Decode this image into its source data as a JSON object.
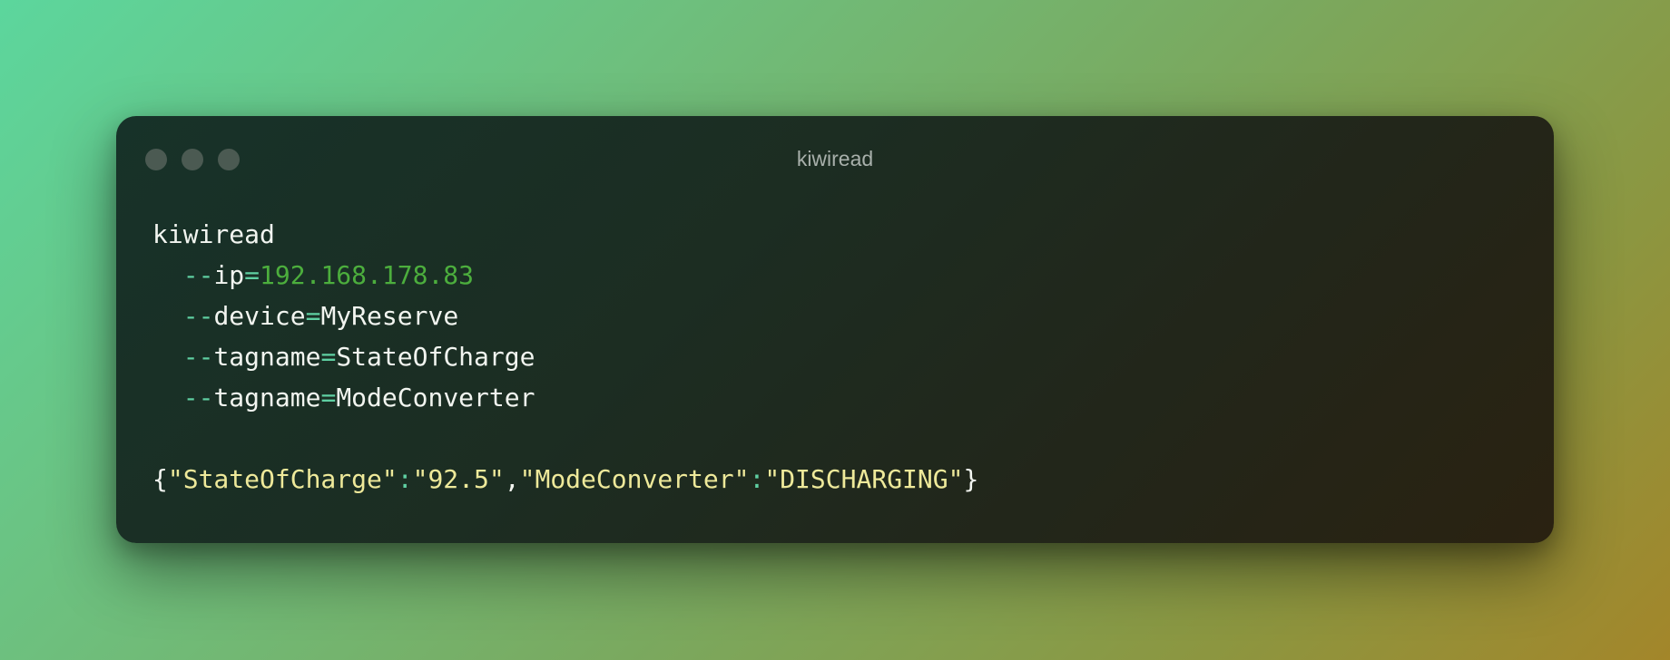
{
  "window": {
    "title": "kiwiread"
  },
  "command": {
    "name": "kiwiread",
    "args": [
      {
        "prefix": "--",
        "flag": "ip",
        "eq": "=",
        "value": "192.168.178.83"
      },
      {
        "prefix": "--",
        "flag": "device",
        "eq": "=",
        "value": "MyReserve"
      },
      {
        "prefix": "--",
        "flag": "tagname",
        "eq": "=",
        "value": "StateOfCharge"
      },
      {
        "prefix": "--",
        "flag": "tagname",
        "eq": "=",
        "value": "ModeConverter"
      }
    ]
  },
  "output": {
    "open_brace": "{",
    "close_brace": "}",
    "comma": ",",
    "colon": ":",
    "pairs": [
      {
        "key": "\"StateOfCharge\"",
        "value": "\"92.5\""
      },
      {
        "key": "\"ModeConverter\"",
        "value": "\"DISCHARGING\""
      }
    ]
  },
  "colors": {
    "flag_accent": "#5fd0a2",
    "ip_value": "#4cae3d",
    "json_string": "#eee99a",
    "text": "#f2f5f0"
  }
}
